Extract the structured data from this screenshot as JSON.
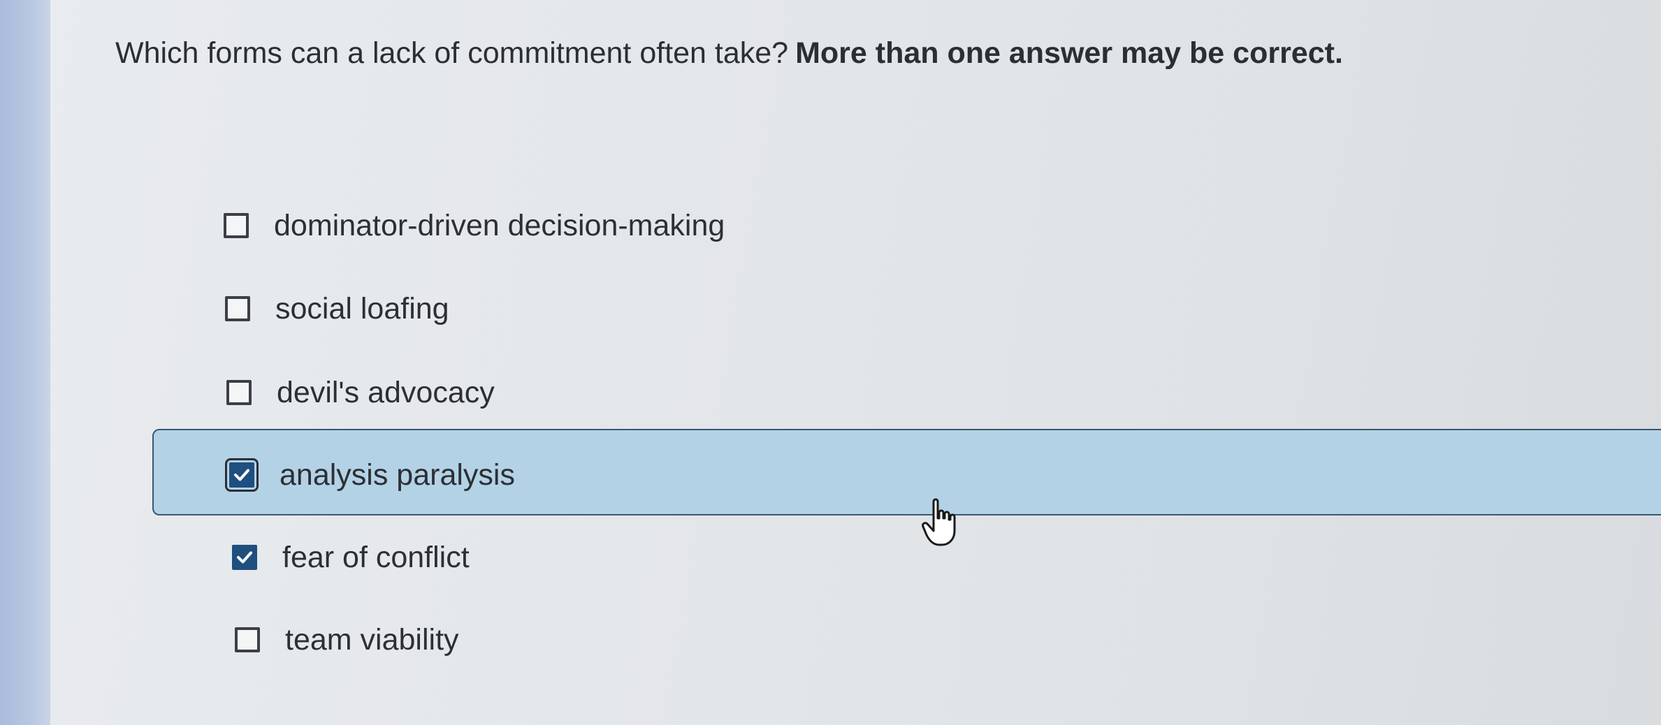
{
  "question": {
    "text": "Which forms can a lack of commitment often take?",
    "instruction": "More than one answer may be correct."
  },
  "options": [
    {
      "label": "dominator-driven decision-making",
      "checked": false
    },
    {
      "label": "social loafing",
      "checked": false
    },
    {
      "label": "devil's advocacy",
      "checked": false
    },
    {
      "label": "analysis paralysis",
      "checked": true,
      "focused": true
    },
    {
      "label": "fear of conflict",
      "checked": true
    },
    {
      "label": "team viability",
      "checked": false
    }
  ],
  "icons": {
    "checkbox_checked": "check-icon",
    "cursor": "hand-pointer-icon"
  },
  "colors": {
    "highlight": "#b4d2e6",
    "checked_box": "#1f4f7e",
    "left_bar": "#b7c7e2"
  }
}
